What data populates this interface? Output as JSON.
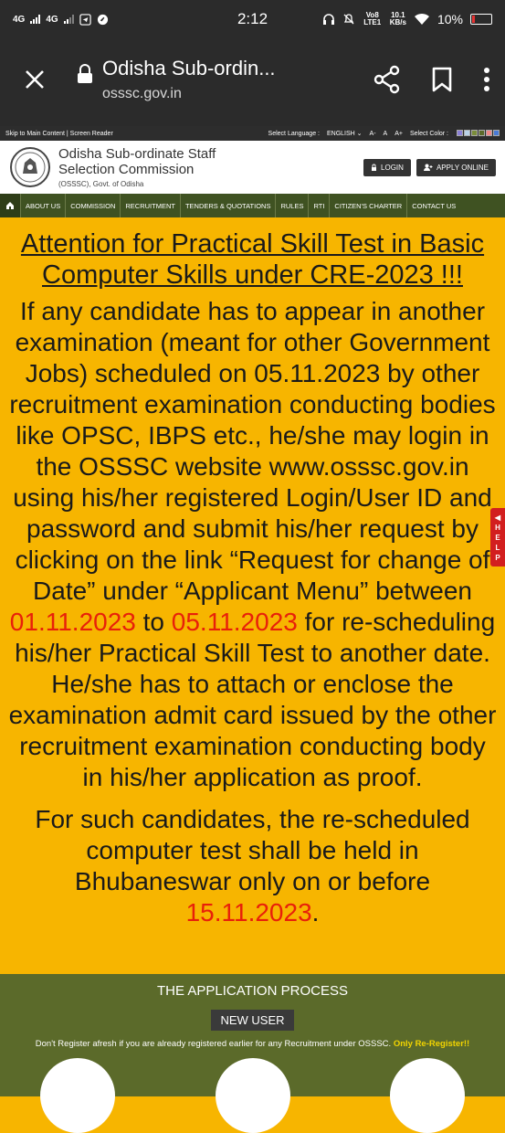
{
  "status": {
    "net1": "4G",
    "net2": "4G",
    "time": "2:12",
    "volte": "Vo8 LTE1",
    "speed_value": "10.1",
    "speed_unit": "KB/s",
    "battery": "10%"
  },
  "browser": {
    "title": "Odisha Sub-ordin...",
    "host": "osssc.gov.in"
  },
  "strip": {
    "skip": "Skip to Main Content | Screen Reader",
    "lang_label": "Select Language :",
    "lang_value": "ENGLISH",
    "font_small": "A-",
    "font_normal": "A",
    "font_large": "A+",
    "color_label": "Select Color :",
    "colors": [
      "#8a7fd6",
      "#b9d1e6",
      "#7a8c3a",
      "#5b6a2a",
      "#e88",
      "#4a7bd6"
    ]
  },
  "header": {
    "org_name_1": "Odisha Sub-ordinate Staff",
    "org_name_2": "Selection Commission",
    "org_sub": "(OSSSC), Govt. of Odisha",
    "login": "LOGIN",
    "apply": "APPLY ONLINE"
  },
  "nav": {
    "items": [
      "ABOUT US",
      "COMMISSION",
      "RECRUITMENT",
      "TENDERS & QUOTATIONS",
      "RULES",
      "RTI",
      "CITIZEN'S CHARTER",
      "CONTACT US"
    ]
  },
  "notice": {
    "title": "Attention for Practical Skill Test in Basic Computer Skills under CRE-2023 !!!",
    "body_a": "If any candidate has to appear in another examination (meant for other Government Jobs) scheduled on 05.11.2023 by other recruitment examination conducting bodies like OPSC, IBPS etc., he/she may login in the OSSSC website www.osssc.gov.in using his/her registered Login/User ID and password and submit his/her request by clicking on the link “Request for change of Date” under “Applicant Menu” between ",
    "date_from": "01.11.2023",
    "to": " to ",
    "date_to": "05.11.2023",
    "body_b": " for re-scheduling his/her Practical Skill Test to another date. He/she has to attach or enclose the examination admit card issued by the other recruitment examination conducting body in his/her application as proof.",
    "para2_a": "For such candidates, the re-scheduled computer test shall be held in Bhubaneswar only on or before ",
    "para2_date": "15.11.2023",
    "para2_end": "."
  },
  "help": {
    "label": "HELP"
  },
  "application": {
    "title": "THE APPLICATION PROCESS",
    "new_user": "NEW USER",
    "note": "Don't Register afresh if you are already registered earlier for any Recruitment under OSSSC.",
    "note_highlight": "Only Re-Register!!"
  }
}
